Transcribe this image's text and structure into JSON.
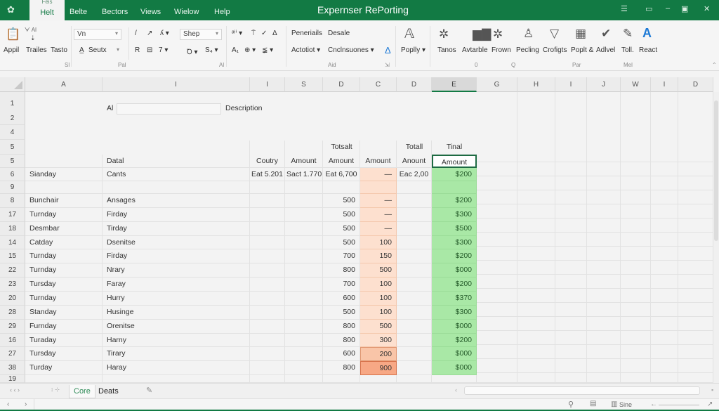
{
  "window": {
    "title": "Expernser RePorting",
    "app_icon": "gear-icon",
    "controls": [
      "ribbon-display-icon",
      "restore-icon",
      "minimize-icon",
      "document-icon",
      "close-icon"
    ],
    "control_glyphs": [
      "☰",
      "▭",
      "–",
      "▣",
      "✕"
    ]
  },
  "tabs": [
    {
      "label": "Helt",
      "sublabel": "Feis",
      "active": true
    },
    {
      "label": "Belte"
    },
    {
      "label": "Bectors"
    },
    {
      "label": "Views"
    },
    {
      "label": "Wielow"
    },
    {
      "label": "Help"
    }
  ],
  "ribbon": {
    "clipboard": {
      "paste_label": "Appil",
      "top_small": "ᗄ Al",
      "buttons": [
        "Trailes",
        "Tasto"
      ],
      "group_label": "Sl"
    },
    "font": {
      "font_name": "Vn",
      "font_size_box": "Seutx",
      "format_buttons_row1": [
        "/",
        "↗",
        "ʎ ▾"
      ],
      "format_buttons_row2": [
        "R",
        "⊟",
        "7 ▾"
      ],
      "style_combo": "Shep",
      "row2_extra": [
        "Ꝺ ▾",
        "S₄ ▾"
      ],
      "group_label": "Pal"
    },
    "alignment": {
      "row1": [
        "ᵃⁱⁱ ▾",
        "⍑",
        "✓",
        "Δ"
      ],
      "row2": [
        "A₁",
        "⊕ ▾",
        "≨ ▾"
      ],
      "group_label": "Al"
    },
    "number": {
      "row1": [
        "Peneriails",
        "Desale"
      ],
      "row2": [
        "Actotiot ▾",
        "Cnclnsuones ▾"
      ],
      "group_label": "Aid",
      "launcher": "⇲"
    },
    "styles": {
      "popily_label": "Poplly ▾"
    },
    "big_buttons": [
      {
        "label": "Tanos",
        "icon": "gear-outline-icon"
      },
      {
        "label": "Avtarble",
        "icon": "bar-chart-icon"
      },
      {
        "label": "Frown",
        "icon": "gear-outline-icon"
      },
      {
        "label": "Pecling",
        "icon": "person-icon"
      },
      {
        "label": "Crofigts",
        "icon": "shape-icon"
      },
      {
        "label": "Poplt &",
        "icon": "table-icon"
      },
      {
        "label": "Adlvel",
        "icon": "check-icon"
      },
      {
        "label": "Toll.",
        "icon": "pin-icon"
      },
      {
        "label": "React",
        "icon": "letter-a-icon"
      }
    ],
    "bottom_labels": [
      "0",
      "Q",
      "Par",
      "Mel"
    ]
  },
  "columns": [
    "A",
    "I",
    "I",
    "S",
    "D",
    "C",
    "D",
    "E",
    "G",
    "H",
    "I",
    "J",
    "W",
    "I",
    "D"
  ],
  "selected_column": "E",
  "sheet": {
    "r1_label": "Al",
    "r1_description": "Description",
    "header_row_top": {
      "total1": "Totsalt",
      "total2": "Totall",
      "final": "Tinal"
    },
    "header_row": {
      "b": "Datal",
      "coutry": "Coutry",
      "amount1": "Amount",
      "amount2": "Amount",
      "amount3": "Amount",
      "amount4": "Anount",
      "final_amount": "Amount"
    },
    "row6": {
      "a": "Sianday",
      "b": "Cants",
      "coutry": "Eat 5.201",
      "amount1": "Sact 1.770",
      "amount2": "Eat 6,700",
      "amount3": "—",
      "amount4": "Eac 2,00",
      "final": "$200"
    },
    "row_numbers_top": [
      "1",
      "2",
      "4",
      "5",
      "5",
      "6",
      "9"
    ],
    "rows": [
      {
        "num": "8",
        "a": "Bunchair",
        "b": "Ansages",
        "d": "500",
        "c": "—",
        "e": "$200"
      },
      {
        "num": "17",
        "a": "Turnday",
        "b": "Firday",
        "d": "500",
        "c": "—",
        "e": "$300"
      },
      {
        "num": "18",
        "a": "Desmbar",
        "b": "Tirday",
        "d": "500",
        "c": "—",
        "e": "$500"
      },
      {
        "num": "14",
        "a": "Catday",
        "b": "Dsenitse",
        "d": "500",
        "c": "100",
        "e": "$300"
      },
      {
        "num": "15",
        "a": "Turnday",
        "b": "Firday",
        "d": "700",
        "c": "150",
        "e": "$200"
      },
      {
        "num": "22",
        "a": "Turnday",
        "b": "Nrary",
        "d": "800",
        "c": "500",
        "e": "$000"
      },
      {
        "num": "23",
        "a": "Tursday",
        "b": "Faray",
        "d": "700",
        "c": "100",
        "e": "$200"
      },
      {
        "num": "20",
        "a": "Turnday",
        "b": "Hurry",
        "d": "600",
        "c": "100",
        "e": "$370"
      },
      {
        "num": "28",
        "a": "Standay",
        "b": "Husinge",
        "d": "500",
        "c": "100",
        "e": "$300"
      },
      {
        "num": "29",
        "a": "Furnday",
        "b": "Orenitse",
        "d": "800",
        "c": "500",
        "e": "$000"
      },
      {
        "num": "16",
        "a": "Turaday",
        "b": "Harny",
        "d": "800",
        "c": "300",
        "e": "$200"
      },
      {
        "num": "27",
        "a": "Tursday",
        "b": "Tirary",
        "d": "600",
        "c": "200",
        "e": "$000"
      },
      {
        "num": "38",
        "a": "Turday",
        "b": "Haray",
        "d": "800",
        "c": "900",
        "e": "$000"
      }
    ],
    "last_row_num": "19"
  },
  "sheet_tabs": {
    "nav": "‹ ‹ ›",
    "active": "Core",
    "other": "Deats",
    "edit_icon": "pencil-icon"
  },
  "statusbar": {
    "view_label": "Sine",
    "nav_left": "‹",
    "nav_right": "›"
  }
}
